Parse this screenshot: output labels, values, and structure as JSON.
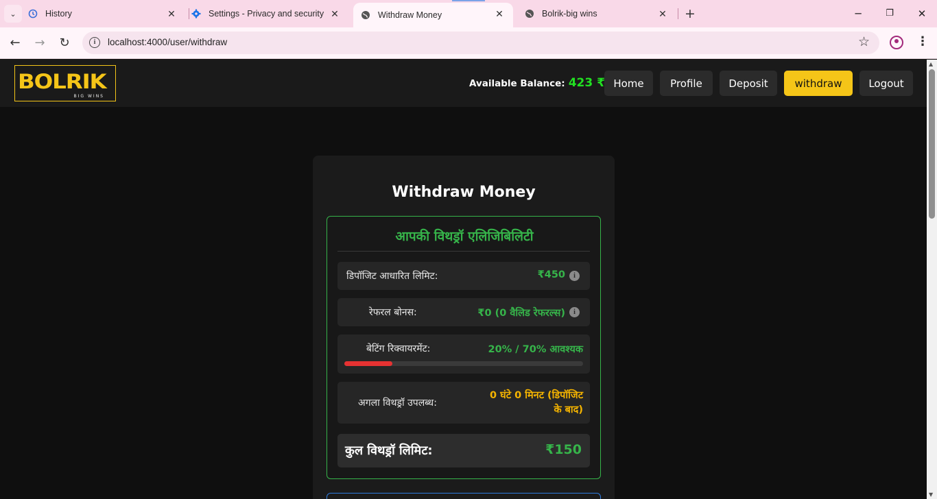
{
  "browser": {
    "tabs": [
      {
        "title": "History",
        "icon": "history-icon"
      },
      {
        "title": "Settings - Privacy and security",
        "icon": "gear-icon"
      },
      {
        "title": "Withdraw Money",
        "icon": "globe-icon",
        "active": true
      },
      {
        "title": "Bolrik-big wins",
        "icon": "globe-icon"
      }
    ],
    "url": "localhost:4000/user/withdraw"
  },
  "header": {
    "logo_text": "BOLRIK",
    "logo_sub": "BIG WINS",
    "balance_label": "Available Balance:",
    "balance_value": "423 ₹",
    "nav": [
      "Home",
      "Profile",
      "Deposit",
      "withdraw",
      "Logout"
    ],
    "active_nav": "withdraw"
  },
  "page": {
    "title": "Withdraw Money",
    "eligibility": {
      "title": "आपकी विथड्रॉ एलिजिबिलिटी",
      "deposit_limit_label": "डिपॉजिट आधारित लिमिट:",
      "deposit_limit_value": "₹450",
      "referral_label": "रेफरल बोनस:",
      "referral_value": "₹0 (0 वैलिड रेफरल्स)",
      "betting_label": "बेटिंग रिक्वायरमेंट:",
      "betting_value": "20% / 70% आवश्यक",
      "betting_progress": 0.2,
      "next_label": "अगला विथड्रॉ उपलब्ध:",
      "next_value_line1": "0 घंटे 0 मिनट (डिपॉजिट",
      "next_value_line2": "के बाद)",
      "total_label": "कुल विथड्रॉ लिमिट:",
      "total_value": "₹150"
    }
  },
  "colors": {
    "accent": "#f5c518",
    "green": "#36b44a",
    "orange": "#f5b400",
    "red": "#e63232"
  }
}
